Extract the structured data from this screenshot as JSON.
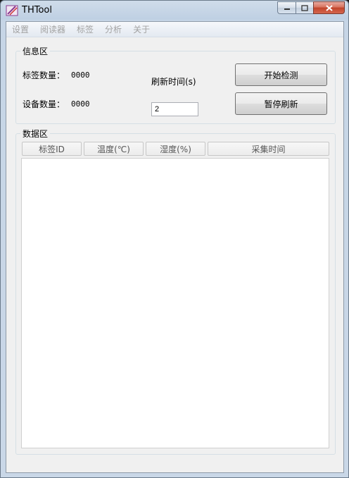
{
  "window": {
    "title": "THTool"
  },
  "menu": [
    "设置",
    "阅读器",
    "标签",
    "分析",
    "关于"
  ],
  "info": {
    "group_title": "信息区",
    "tag_count_label": "标签数量：",
    "tag_count_value": "0000",
    "device_count_label": "设备数量：",
    "device_count_value": "0000",
    "refresh_label": "刷新时间(s)",
    "refresh_value": "2",
    "start_button": "开始检测",
    "pause_button": "暂停刷新"
  },
  "data": {
    "group_title": "数据区",
    "columns": [
      "标签ID",
      "温度(℃)",
      "湿度(%)",
      "采集时间"
    ],
    "rows": []
  }
}
